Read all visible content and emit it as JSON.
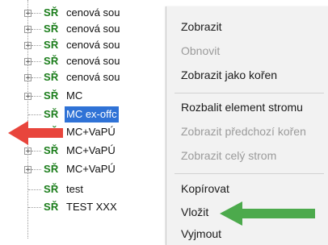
{
  "tree": {
    "items": [
      {
        "code": "SŘ",
        "label": "cenová sou",
        "expandable": true
      },
      {
        "code": "SŘ",
        "label": "cenová sou",
        "expandable": true
      },
      {
        "code": "SŘ",
        "label": "cenová sou",
        "expandable": true
      },
      {
        "code": "SŘ",
        "label": "cenová sou",
        "expandable": true
      },
      {
        "code": "SŘ",
        "label": "cenová sou",
        "expandable": true
      },
      {
        "code": "SŘ",
        "label": "MC",
        "expandable": true
      },
      {
        "code": "SŘ",
        "label": "MC ex-offc",
        "expandable": false,
        "selected": true
      },
      {
        "code": "SŘ",
        "label": "MC+VaPÚ",
        "expandable": true
      },
      {
        "code": "SŘ",
        "label": "MC+VaPÚ",
        "expandable": true
      },
      {
        "code": "SŘ",
        "label": "MC+VaPÚ",
        "expandable": true
      },
      {
        "code": "SŘ",
        "label": "test",
        "expandable": false
      },
      {
        "code": "SŘ",
        "label": "TEST XXX",
        "expandable": false
      }
    ],
    "expander_symbol": "+"
  },
  "context_menu": {
    "items": [
      {
        "label": "Zobrazit",
        "enabled": true
      },
      {
        "label": "Obnovit",
        "enabled": false
      },
      {
        "label": "Zobrazit jako kořen",
        "enabled": true
      },
      {
        "label": "Rozbalit element stromu",
        "enabled": true
      },
      {
        "label": "Zobrazit předchozí kořen",
        "enabled": false
      },
      {
        "label": "Zobrazit celý strom",
        "enabled": false
      },
      {
        "label": "Kopírovat",
        "enabled": true
      },
      {
        "label": "Vložit",
        "enabled": true
      },
      {
        "label": "Vyjmout",
        "enabled": true
      }
    ]
  },
  "annotations": {
    "arrow_color_red": "#e8453c",
    "arrow_color_green": "#4caa4c"
  }
}
